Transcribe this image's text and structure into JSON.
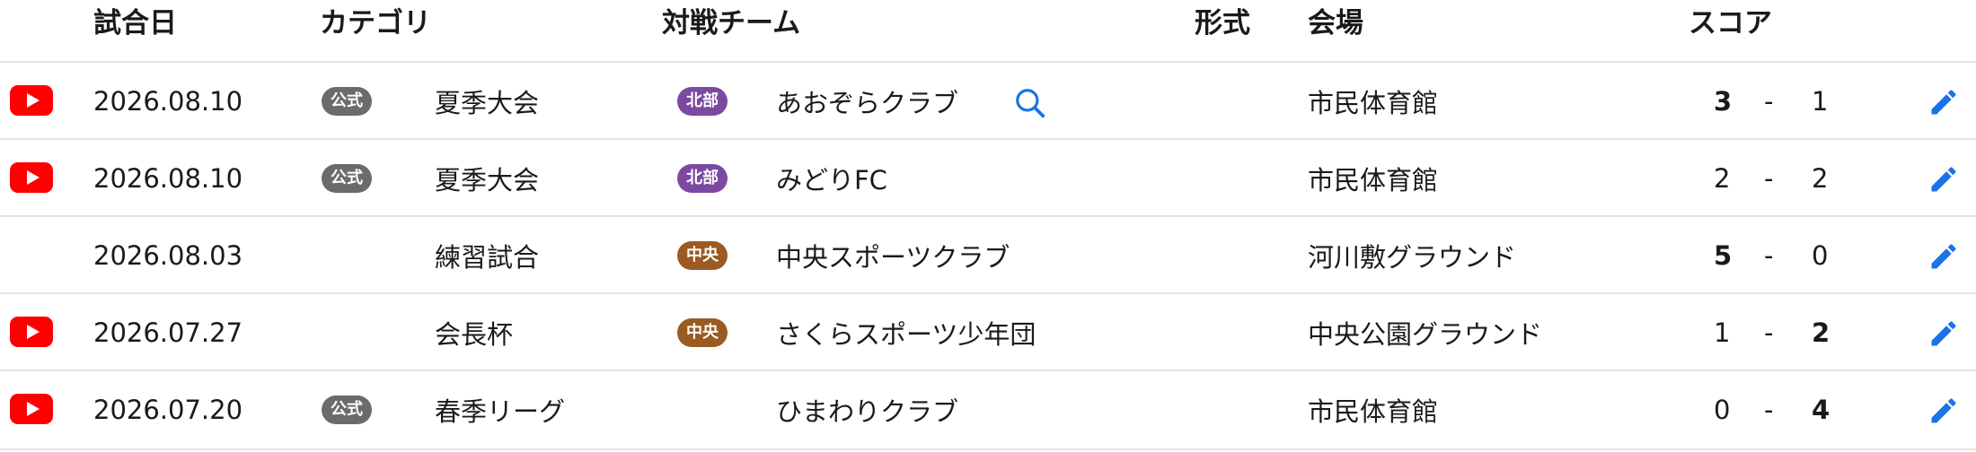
{
  "headers": {
    "date": "試合日",
    "category": "カテゴリ",
    "opponent": "対戦チーム",
    "format": "形式",
    "venue": "会場",
    "score": "スコア"
  },
  "colors": {
    "official_badge": "#6b6b6b",
    "north_badge": "#7b4aa0",
    "central_badge": "#9a5a22",
    "youtube": "#ff0000",
    "edit": "#1a73e8",
    "search": "#1a73e8"
  },
  "score_separator": "-",
  "rows": [
    {
      "has_video": true,
      "date": "2026.08.10",
      "official": "公式",
      "category": "夏季大会",
      "area": "北部",
      "area_color": "#7b4aa0",
      "opponent": "あおぞらクラブ",
      "has_search": true,
      "format": "",
      "venue": "市民体育館",
      "home": "3",
      "away": "1",
      "home_win": true,
      "away_win": false
    },
    {
      "has_video": true,
      "date": "2026.08.10",
      "official": "公式",
      "category": "夏季大会",
      "area": "北部",
      "area_color": "#7b4aa0",
      "opponent": "みどりFC",
      "has_search": false,
      "format": "",
      "venue": "市民体育館",
      "home": "2",
      "away": "2",
      "home_win": false,
      "away_win": false
    },
    {
      "has_video": false,
      "date": "2026.08.03",
      "official": "",
      "category": "練習試合",
      "area": "中央",
      "area_color": "#9a5a22",
      "opponent": "中央スポーツクラブ",
      "has_search": false,
      "format": "",
      "venue": "河川敷グラウンド",
      "home": "5",
      "away": "0",
      "home_win": true,
      "away_win": false
    },
    {
      "has_video": true,
      "date": "2026.07.27",
      "official": "",
      "category": "会長杯",
      "area": "中央",
      "area_color": "#9a5a22",
      "opponent": "さくらスポーツ少年団",
      "has_search": false,
      "format": "",
      "venue": "中央公園グラウンド",
      "home": "1",
      "away": "2",
      "home_win": false,
      "away_win": true
    },
    {
      "has_video": true,
      "date": "2026.07.20",
      "official": "公式",
      "category": "春季リーグ",
      "area": "",
      "area_color": "",
      "opponent": "ひまわりクラブ",
      "has_search": false,
      "format": "",
      "venue": "市民体育館",
      "home": "0",
      "away": "4",
      "home_win": false,
      "away_win": true
    }
  ]
}
